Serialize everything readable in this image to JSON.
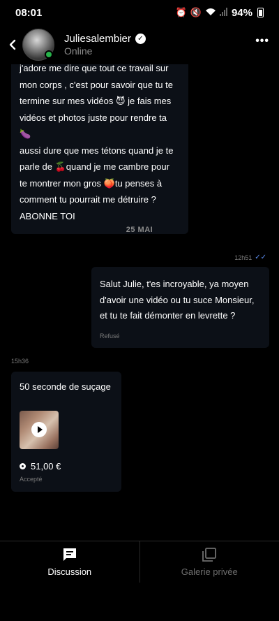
{
  "status_bar": {
    "time": "08:01",
    "battery": "94%",
    "icons": [
      "alarm-icon",
      "mute-icon",
      "wifi-icon",
      "signal-icon",
      "battery-icon"
    ]
  },
  "header": {
    "back_icon": "chevron-left-icon",
    "username": "Juliesalembier",
    "verified_icon": "verified-badge-icon",
    "presence": "Online",
    "more_icon": "more-dots-icon"
  },
  "messages": [
    {
      "direction": "incoming",
      "lines": [
        "j'adore me dire que tout ce travail sur",
        "mon corps , c'est pour savoir que tu te",
        "termine sur mes vidéos 😈 je fais mes",
        "vidéos et photos juste pour rendre ta 🍆",
        "aussi dure que mes tétons quand je te",
        "parle de 🍒quand je me cambre pour",
        "te montrer mon gros 🍑tu penses à",
        "comment tu pourrait me détruire ?",
        "ABONNE TOI"
      ]
    },
    {
      "direction": "outgoing",
      "time": "12h51",
      "lines": [
        "Salut Julie, t'es incroyable, ya moyen",
        "d'avoir une vidéo ou tu suce Monsieur,",
        "et tu te fait démonter en levrette ?"
      ],
      "status": "Refusé"
    },
    {
      "direction": "incoming",
      "time": "15h36",
      "text": "50 seconde de suçage",
      "price": "51,00 €",
      "status": "Accepté"
    }
  ],
  "date_separator": "25 MAI",
  "tabs": [
    {
      "label": "Discussion",
      "icon": "chat-icon",
      "active": true
    },
    {
      "label": "Galerie privée",
      "icon": "gallery-icon",
      "active": false
    }
  ],
  "colors": {
    "background": "#000000",
    "bubble": "#0c1017",
    "muted": "#8d8d8d",
    "online": "#27b24a",
    "read_ticks": "#5b8df0"
  }
}
